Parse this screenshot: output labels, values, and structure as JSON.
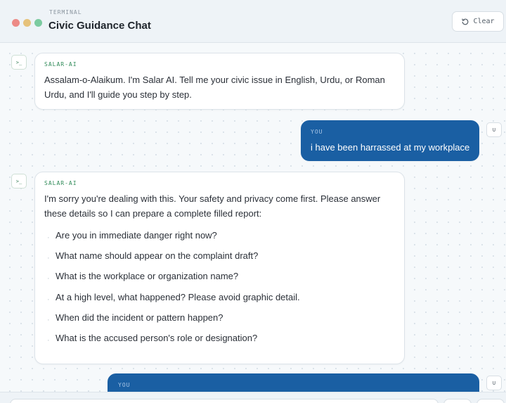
{
  "header": {
    "eyebrow": "TERMINAL",
    "title": "Civic Guidance Chat",
    "clear_label": "Clear",
    "window_dots": [
      "#ec8a86",
      "#e6c27b",
      "#7ccba0"
    ]
  },
  "messages": [
    {
      "role": "assistant",
      "avatar": ">_",
      "sender": "SALAR-AI",
      "lines": [
        "Assalam-o-Alaikum. I'm Salar AI. Tell me your civic issue in English, Urdu, or Roman",
        "Urdu, and I'll guide you step by step."
      ]
    },
    {
      "role": "user",
      "avatar": "U",
      "sender": "YOU",
      "text": "i have been harrassed at my workplace"
    },
    {
      "role": "assistant",
      "avatar": ">_",
      "sender": "SALAR-AI",
      "lines": [
        "I'm sorry you're dealing with this. Your safety and privacy come first. Please answer",
        "these details so I can prepare a complete filled report:"
      ],
      "questions": [
        "Are you in immediate danger right now?",
        "What name should appear on the complaint draft?",
        "What is the workplace or organization name?",
        "At a high level, what happened? Please avoid graphic detail.",
        "When did the incident or pattern happen?",
        "What is the accused person's role or designation?"
      ]
    },
    {
      "role": "user",
      "avatar": "U",
      "sender": "YOU",
      "text": ""
    }
  ],
  "colors": {
    "accent": "#1a5fa3",
    "ai_label": "#2f8a58"
  }
}
